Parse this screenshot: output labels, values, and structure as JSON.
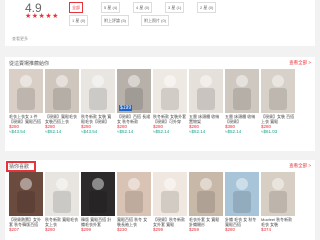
{
  "rating": {
    "score": "4.9",
    "stars": "★★★★★",
    "stars_count": 5
  },
  "filters": [
    {
      "label": "全部",
      "active": true
    },
    {
      "label": "5 星 (4)",
      "active": false
    },
    {
      "label": "4 星 (0)",
      "active": false
    },
    {
      "label": "3 星 (1)",
      "active": false
    },
    {
      "label": "2 星 (0)",
      "active": false
    },
    {
      "label": "1 星 (0)",
      "active": false
    },
    {
      "label": "附上評論 (5)",
      "active": false
    },
    {
      "label": "附上照片 (0)",
      "active": false
    }
  ],
  "loadmore": "查看更多",
  "section_a": {
    "title": "從這賣場推薦給你",
    "more": "查看全部 >",
    "items": [
      {
        "name": "毛衣上衣女 3 件【現貨】寬鬆百搭",
        "p1": "$280",
        "p2": "≈$43.54",
        "badge": "",
        "pricebadge": ""
      },
      {
        "name": "【現貨】寬鬆毛衣 女裝百搭上衣",
        "p1": "$280",
        "p2": "≈$52.14",
        "badge": "",
        "pricebadge": ""
      },
      {
        "name": "秋冬新款 女裝 寬鬆毛衣【現貨】",
        "p1": "$280",
        "p2": "≈$43.54",
        "badge": "",
        "pricebadge": ""
      },
      {
        "name": "【現貨】百搭 長裙 女 秋冬新款",
        "p1": "$280",
        "p2": "≈$52.14",
        "badge": "",
        "pricebadge": "$199"
      },
      {
        "name": "秋冬新款 女裝外套【現貨】可外穿",
        "p1": "$280",
        "p2": "≈$52.14",
        "badge": "",
        "pricebadge": ""
      },
      {
        "name": "五層 床頭櫃 收納 置物架",
        "p1": "$280",
        "p2": "≈$52.14",
        "badge": "",
        "pricebadge": ""
      },
      {
        "name": "五層 床頭櫃 收納【現貨】",
        "p1": "$380",
        "p2": "≈$52.14",
        "badge": "",
        "pricebadge": ""
      },
      {
        "name": "【現貨】女裝 百搭上衣 寬鬆",
        "p1": "$280",
        "p2": "≈$61.03",
        "badge": "",
        "pricebadge": ""
      }
    ]
  },
  "section_b": {
    "title": "猜你喜歡",
    "more": "查看全部 >",
    "items": [
      {
        "name": "【現貨熱賣】女外套 秋冬韓版百搭",
        "p1": "$207",
        "p2": "",
        "badge": "",
        "pricebadge": ""
      },
      {
        "name": "秋冬新款 寬鬆毛衣 女上衣",
        "p1": "$280",
        "p2": "",
        "badge": "",
        "pricebadge": ""
      },
      {
        "name": "韓版 寬鬆百搭 針織毛衣外套",
        "p1": "$299",
        "p2": "",
        "badge": "",
        "pricebadge": ""
      },
      {
        "name": "寬鬆百搭 秋冬 女裝長袖上衣",
        "p1": "$230",
        "p2": "",
        "badge": "",
        "pricebadge": ""
      },
      {
        "name": "【現貨】秋冬新款 女外套 寬鬆",
        "p1": "$299",
        "p2": "",
        "badge": "",
        "pricebadge": ""
      },
      {
        "name": "毛衣外套 女 寬鬆 針織開衫",
        "p1": "$259",
        "p2": "",
        "badge": "",
        "pricebadge": ""
      },
      {
        "name": "針織 毛衣 女 秋冬 寬鬆百搭",
        "p1": "$280",
        "p2": "",
        "badge": "",
        "pricebadge": ""
      },
      {
        "name": "Mocfeel 秋冬新款 毛衣 女裝",
        "p1": "$374",
        "p2": "",
        "badge": "",
        "pricebadge": ""
      }
    ]
  },
  "colors": {
    "accent": "#e8323c",
    "teal": "#1aa18a",
    "blue": "#1e63c8"
  }
}
